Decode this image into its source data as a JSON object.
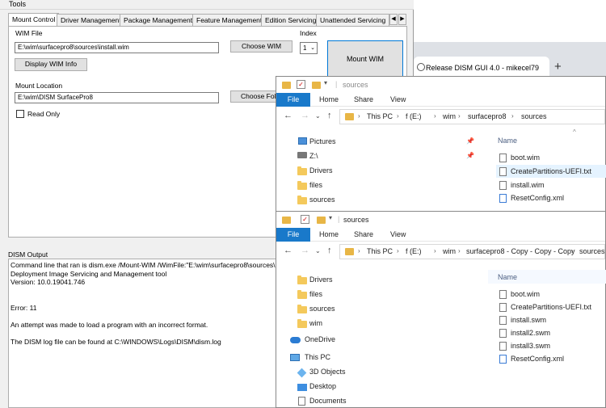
{
  "dism": {
    "menu_tools": "Tools",
    "tabs": [
      "Mount Control",
      "Driver Management",
      "Package Management",
      "Feature Management",
      "Edition Servicing",
      "Unattended Servicing"
    ],
    "wim_file_label": "WIM File",
    "wim_file_value": "E:\\wim\\surfacepro8\\sources\\install.wim",
    "choose_wim": "Choose WIM",
    "index_label": "Index",
    "index_value": "1",
    "display_wim_info": "Display WIM Info",
    "mount_wim": "Mount WIM",
    "mount_location_label": "Mount Location",
    "mount_location_value": "E:\\wim\\DISM SurfacePro8",
    "choose_folder": "Choose Fold",
    "read_only": "Read Only",
    "output_label": "DISM Output",
    "output_lines": [
      "Command line that ran is dism.exe /Mount-WIM /WimFile:\"E:\\wim\\surfacepro8\\sources\\instal",
      "Deployment Image Servicing and Management tool",
      "Version: 10.0.19041.746",
      "",
      "",
      "Error: 11",
      "",
      "An attempt was made to load a program with an incorrect format.",
      "",
      "The DISM log file can be found at C:\\WINDOWS\\Logs\\DISM\\dism.log"
    ]
  },
  "browser": {
    "tab_title": "Release DISM GUI 4.0 - mikecel79",
    "new_tab": "+"
  },
  "explorer1": {
    "title": "sources",
    "ribbon_tabs": [
      "File",
      "Home",
      "Share",
      "View"
    ],
    "path": [
      "This PC",
      "f (E:)",
      "wim",
      "surfacepro8",
      "sources"
    ],
    "nav": [
      "Pictures",
      "Z:\\",
      "Drivers",
      "files",
      "sources"
    ],
    "column_name": "Name",
    "files": [
      "boot.wim",
      "CreatePartitions-UEFI.txt",
      "install.wim",
      "ResetConfig.xml"
    ]
  },
  "explorer2": {
    "title": "sources",
    "ribbon_tabs": [
      "File",
      "Home",
      "Share",
      "View"
    ],
    "path": [
      "This PC",
      "f (E:)",
      "wim",
      "surfacepro8 - Copy - Copy - Copy",
      "sources"
    ],
    "nav": [
      "Drivers",
      "files",
      "sources",
      "wim",
      "OneDrive",
      "This PC",
      "3D Objects",
      "Desktop",
      "Documents"
    ],
    "column_name": "Name",
    "files": [
      "boot.wim",
      "CreatePartitions-UEFI.txt",
      "install.swm",
      "install2.swm",
      "install3.swm",
      "ResetConfig.xml"
    ]
  }
}
